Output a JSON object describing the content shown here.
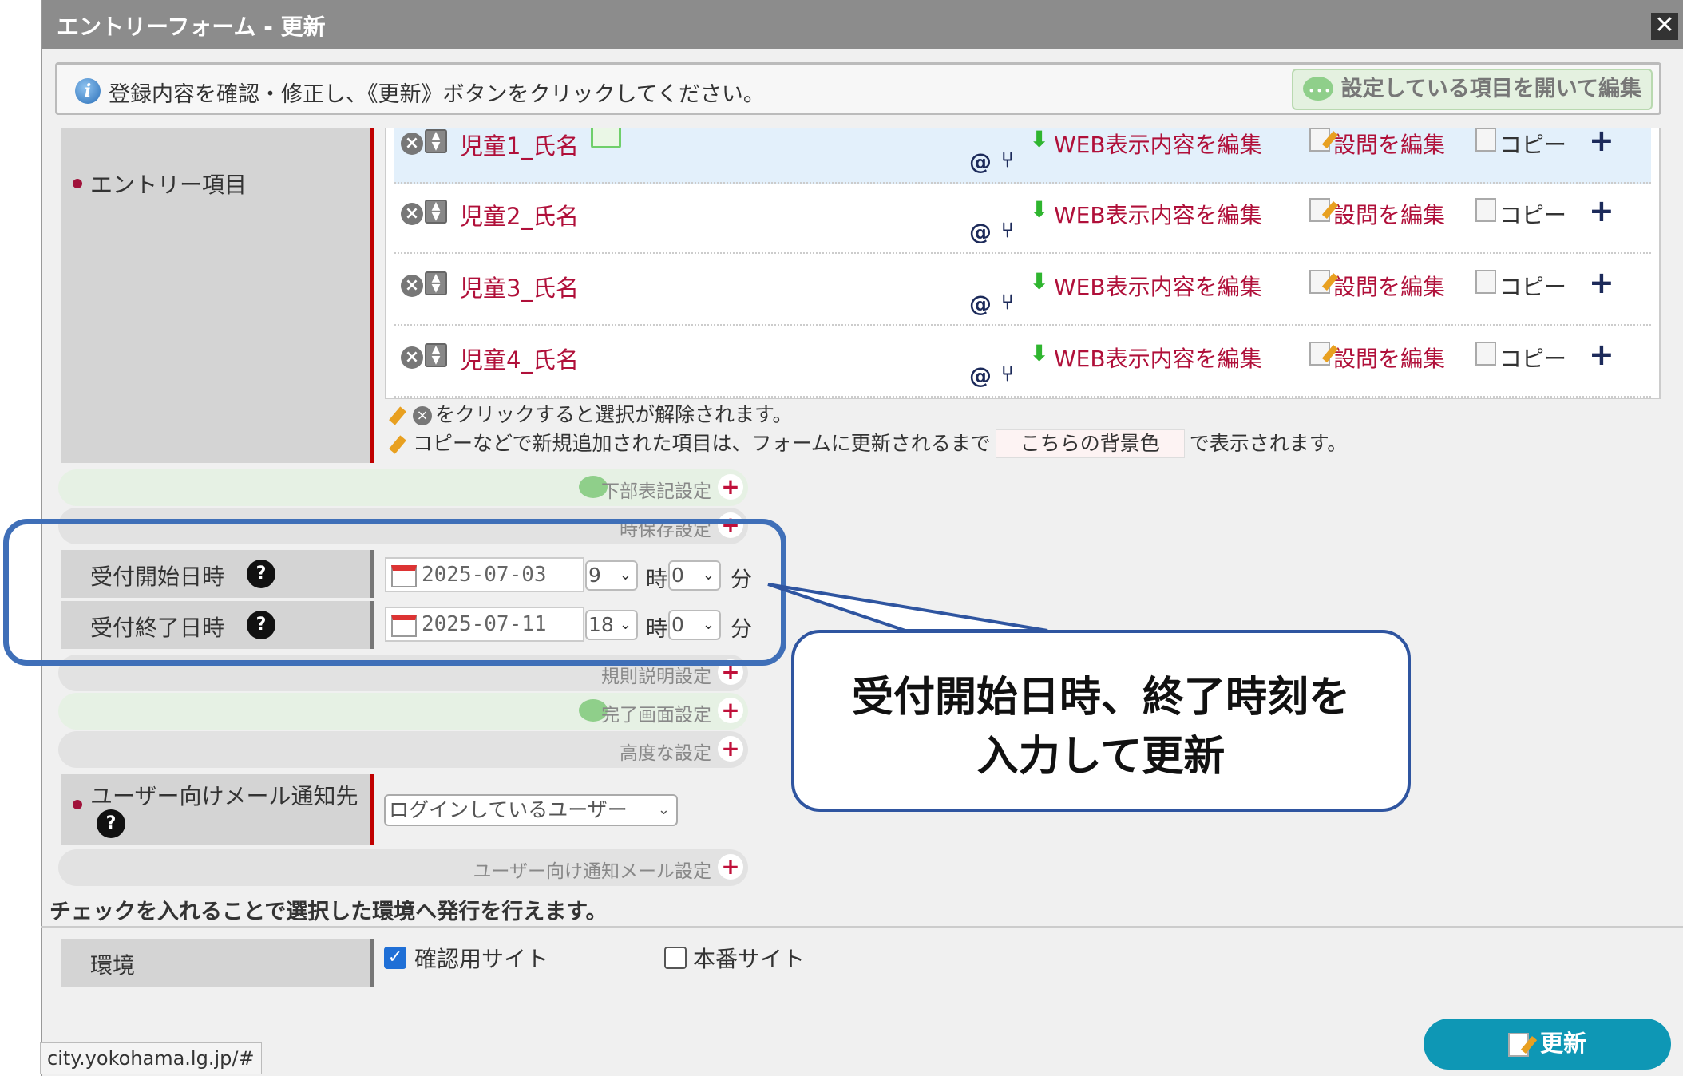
{
  "dialog": {
    "title": "エントリーフォーム - 更新",
    "close_label": "✕"
  },
  "infobar": {
    "message": "登録内容を確認・修正し、《更新》ボタンをクリックしてください。",
    "open_edit_button": "設定している項目を開いて編集"
  },
  "entry_section": {
    "label": "エントリー項目",
    "rows": [
      {
        "name": "児童1_氏名",
        "web_edit": "WEB表示内容を編集",
        "question_edit": "設問を編集",
        "copy": "コピー"
      },
      {
        "name": "児童2_氏名",
        "web_edit": "WEB表示内容を編集",
        "question_edit": "設問を編集",
        "copy": "コピー"
      },
      {
        "name": "児童3_氏名",
        "web_edit": "WEB表示内容を編集",
        "question_edit": "設問を編集",
        "copy": "コピー"
      },
      {
        "name": "児童4_氏名",
        "web_edit": "WEB表示内容を編集",
        "question_edit": "設問を編集",
        "copy": "コピー"
      }
    ],
    "note1": "をクリックすると選択が解除されます。",
    "note2_before": "コピーなどで新規追加された項目は、フォームに更新されるまで",
    "note2_sample": "こちらの背景色",
    "note2_after": "で表示されます。"
  },
  "settings": {
    "footer_setting": "下部表記設定",
    "temp_save_setting": "時保存設定",
    "rules_setting": "規則説明設定",
    "complete_setting": "完了画面設定",
    "advanced_setting": "高度な設定",
    "user_mail_setting": "ユーザー向け通知メール設定"
  },
  "reception": {
    "start_label": "受付開始日時",
    "start_date": "2025-07-03",
    "start_hour": "9",
    "start_minute": "0",
    "end_label": "受付終了日時",
    "end_date": "2025-07-11",
    "end_hour": "18",
    "end_minute": "0",
    "hour_unit": "時",
    "minute_unit": "分"
  },
  "callout": {
    "line1": "受付開始日時、終了時刻を",
    "line2": "入力して更新"
  },
  "user_mail": {
    "label": "ユーザー向けメール通知先",
    "selected": "ログインしているユーザー"
  },
  "publish": {
    "note": "チェックを入れることで選択した環境へ発行を行えます。",
    "env_label": "環境",
    "confirm_site": "確認用サイト",
    "confirm_checked": true,
    "production_site": "本番サイト",
    "production_checked": false
  },
  "update_button": "更新",
  "status_url": "city.yokohama.lg.jp/#",
  "colors": {
    "accent_red": "#b0103a",
    "button_teal": "#0e97b5",
    "callout_blue": "#3f6fb8"
  }
}
